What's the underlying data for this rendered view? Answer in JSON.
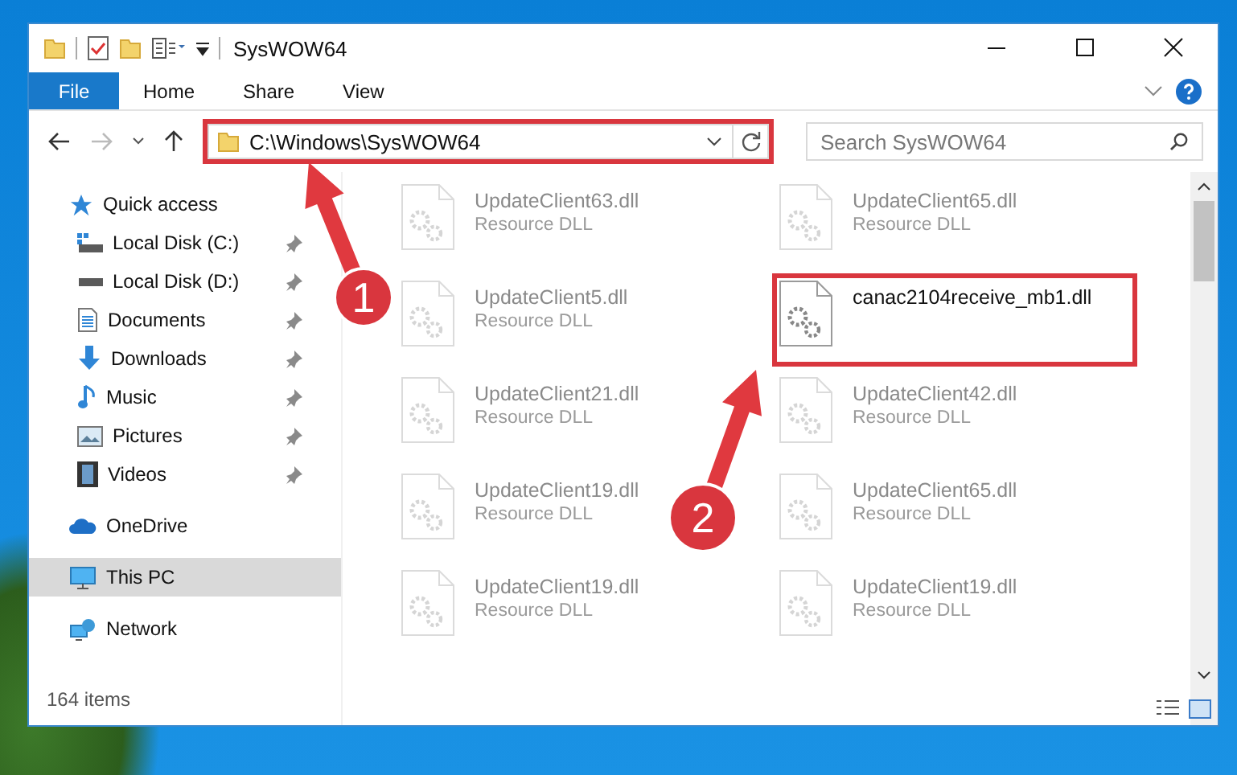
{
  "window": {
    "title": "SysWOW64"
  },
  "ribbon": {
    "file_button": "File",
    "tabs": [
      {
        "label": "Home",
        "selected": false
      },
      {
        "label": "Share",
        "selected": false
      },
      {
        "label": "View",
        "selected": false
      }
    ]
  },
  "address_bar": {
    "path": "C:\\Windows\\SysWOW64",
    "highlighted": true
  },
  "search": {
    "placeholder": "Search SysWOW64"
  },
  "sidebar": {
    "items": [
      {
        "label": "Quick access",
        "selected": false,
        "children": [
          {
            "label": "Local Disk (C:)",
            "pinned": true
          },
          {
            "label": "Local Disk (D:)",
            "pinned": true
          },
          {
            "label": "Documents",
            "pinned": true
          },
          {
            "label": "Downloads",
            "pinned": true
          },
          {
            "label": "Music",
            "pinned": true
          },
          {
            "label": "Pictures",
            "pinned": true
          },
          {
            "label": "Videos",
            "pinned": true
          }
        ]
      },
      {
        "label": "OneDrive",
        "selected": false
      },
      {
        "label": "This PC",
        "selected": true
      },
      {
        "label": "Network",
        "selected": false
      }
    ]
  },
  "files": [
    {
      "name": "UpdateClient63.dll",
      "type": "Resource DLL",
      "dimmed": true,
      "highlighted": false
    },
    {
      "name": "UpdateClient65.dll",
      "type": "Resource DLL",
      "dimmed": true,
      "highlighted": false
    },
    {
      "name": "UpdateClient5.dll",
      "type": "Resource DLL",
      "dimmed": true,
      "highlighted": false
    },
    {
      "name": "canac2104receive_mb1.dll",
      "dimmed": false,
      "highlighted": true
    },
    {
      "name": "UpdateClient21.dll",
      "type": "Resource DLL",
      "dimmed": true,
      "highlighted": false
    },
    {
      "name": "UpdateClient42.dll",
      "type": "Resource DLL",
      "dimmed": true,
      "highlighted": false
    },
    {
      "name": "UpdateClient19.dll",
      "type": "Resource DLL",
      "dimmed": true,
      "highlighted": false
    },
    {
      "name": "UpdateClient65.dll",
      "type": "Resource DLL",
      "dimmed": true,
      "highlighted": false
    },
    {
      "name": "UpdateClient19.dll",
      "type": "Resource DLL",
      "dimmed": true,
      "highlighted": false
    },
    {
      "name": "UpdateClient19.dll",
      "type": "Resource DLL",
      "dimmed": true,
      "highlighted": false
    }
  ],
  "status_bar": {
    "item_count": "164 items"
  },
  "annotations": [
    {
      "step": "1"
    },
    {
      "step": "2"
    }
  ]
}
